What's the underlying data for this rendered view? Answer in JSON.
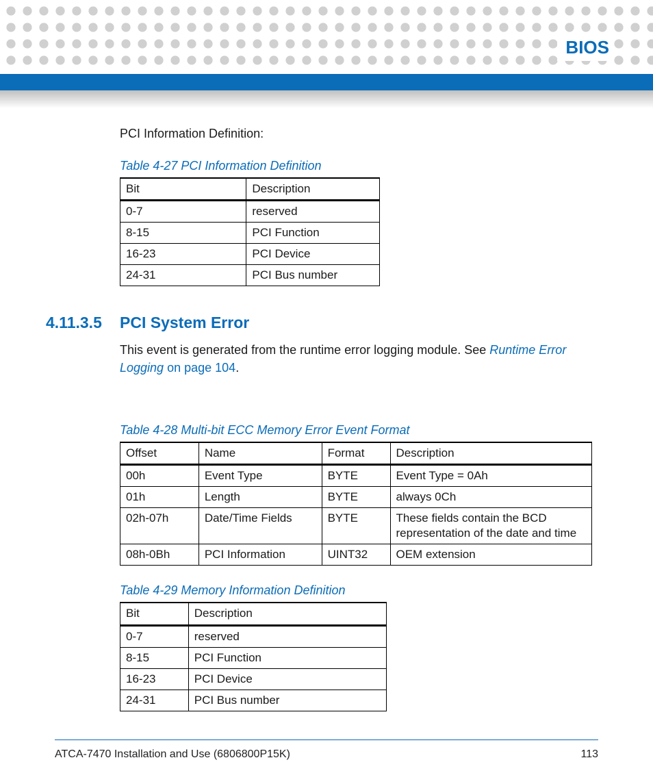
{
  "header": {
    "title": "BIOS"
  },
  "intro_text": "PCI Information Definition:",
  "table27": {
    "caption": "Table 4-27 PCI Information Definition",
    "headers": [
      "Bit",
      "Description"
    ],
    "rows": [
      [
        "0-7",
        "reserved"
      ],
      [
        "8-15",
        "PCI Function"
      ],
      [
        "16-23",
        "PCI Device"
      ],
      [
        "24-31",
        "PCI Bus number"
      ]
    ]
  },
  "section": {
    "number": "4.11.3.5",
    "title": "PCI System Error",
    "para_pre": "This event is generated from the runtime error logging module. See ",
    "link_text": "Runtime Error Logging",
    "link_tail": " on page 104",
    "period": "."
  },
  "table28": {
    "caption": "Table 4-28 Multi-bit ECC Memory Error Event Format",
    "headers": [
      "Offset",
      "Name",
      "Format",
      "Description"
    ],
    "rows": [
      [
        "00h",
        "Event Type",
        "BYTE",
        "Event Type = 0Ah"
      ],
      [
        "01h",
        "Length",
        "BYTE",
        "always 0Ch"
      ],
      [
        "02h-07h",
        "Date/Time Fields",
        "BYTE",
        "These fields contain the BCD representation of the date and time"
      ],
      [
        "08h-0Bh",
        "PCI Information",
        "UINT32",
        "OEM extension"
      ]
    ]
  },
  "table29": {
    "caption": "Table 4-29 Memory Information Definition",
    "headers": [
      "Bit",
      "Description"
    ],
    "rows": [
      [
        "0-7",
        "reserved"
      ],
      [
        "8-15",
        "PCI Function"
      ],
      [
        "16-23",
        "PCI Device"
      ],
      [
        "24-31",
        "PCI Bus number"
      ]
    ]
  },
  "footer": {
    "left": "ATCA-7470 Installation and Use (6806800P15K)",
    "right": "113"
  }
}
